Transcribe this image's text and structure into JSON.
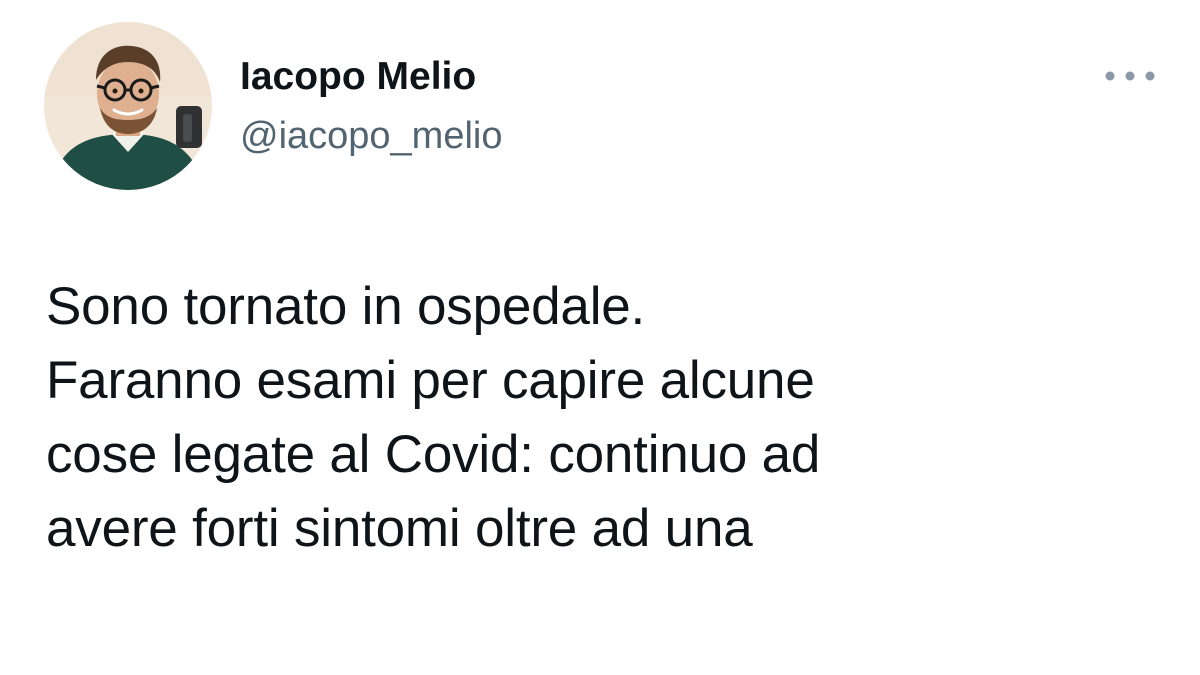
{
  "author": {
    "display_name": "Iacopo Melio",
    "handle": "@iacopo_melio",
    "avatar_icon": "avatar-photo"
  },
  "more_button": {
    "icon": "more-dots-icon"
  },
  "tweet": {
    "lines": [
      "Sono tornato in ospedale.",
      "Faranno esami per capire alcune",
      "cose legate al Covid: continuo ad",
      "avere forti sintomi oltre ad una"
    ]
  },
  "colors": {
    "text": "#0f1419",
    "secondary_text": "#536471",
    "background": "#ffffff",
    "more_dots": "#8b98a5"
  }
}
